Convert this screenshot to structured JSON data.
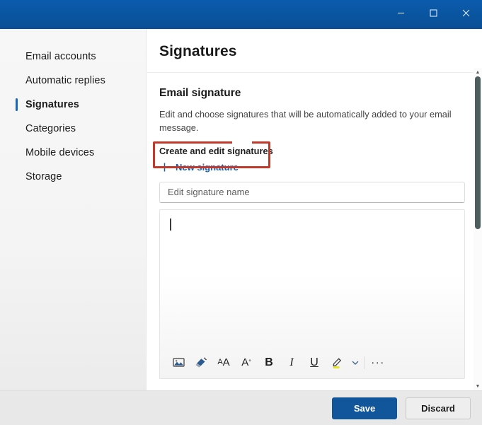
{
  "window": {
    "controls": [
      {
        "name": "minimize",
        "label": "Minimize"
      },
      {
        "name": "maximize",
        "label": "Maximize"
      },
      {
        "name": "close",
        "label": "Close"
      }
    ],
    "titlebar_color": "#0a55a2"
  },
  "sidebar": {
    "items": [
      {
        "label": "Email accounts",
        "active": false
      },
      {
        "label": "Automatic replies",
        "active": false
      },
      {
        "label": "Signatures",
        "active": true
      },
      {
        "label": "Categories",
        "active": false
      },
      {
        "label": "Mobile devices",
        "active": false
      },
      {
        "label": "Storage",
        "active": false
      }
    ],
    "accent_color": "#1767b5"
  },
  "main": {
    "page_title": "Signatures",
    "section_title": "Email signature",
    "section_description": "Edit and choose signatures that will be automatically added to your email message.",
    "sub_label": "Create and edit signatures",
    "new_signature_label": "New signature",
    "new_signature_color": "#1b5fa8",
    "name_input": {
      "value": "",
      "placeholder": "Edit signature name"
    },
    "editor": {
      "value": "",
      "caret_visible": true
    },
    "toolbar": [
      {
        "name": "insert-picture-icon",
        "label": "Insert picture"
      },
      {
        "name": "format-painter-icon",
        "label": "Format painter"
      },
      {
        "name": "font-size-icon",
        "label": "Font size",
        "glyph": "AA"
      },
      {
        "name": "clear-formatting-icon",
        "label": "Clear formatting",
        "glyph": "A°"
      },
      {
        "name": "bold-icon",
        "label": "Bold",
        "glyph": "B"
      },
      {
        "name": "italic-icon",
        "label": "Italic",
        "glyph": "I"
      },
      {
        "name": "underline-icon",
        "label": "Underline",
        "glyph": "U"
      },
      {
        "name": "highlight-icon",
        "label": "Text highlight color"
      },
      {
        "name": "chevron-down-icon",
        "label": "More highlight colors"
      },
      {
        "name": "more-options-icon",
        "label": "More formatting options",
        "glyph": "···"
      }
    ]
  },
  "annotation": {
    "color": "#c0392b",
    "target": "signature-editor-body"
  },
  "scrollbar": {
    "up_arrow": "▲",
    "down_arrow": "▼"
  },
  "footer": {
    "save_label": "Save",
    "discard_label": "Discard",
    "save_color": "#11559b"
  }
}
